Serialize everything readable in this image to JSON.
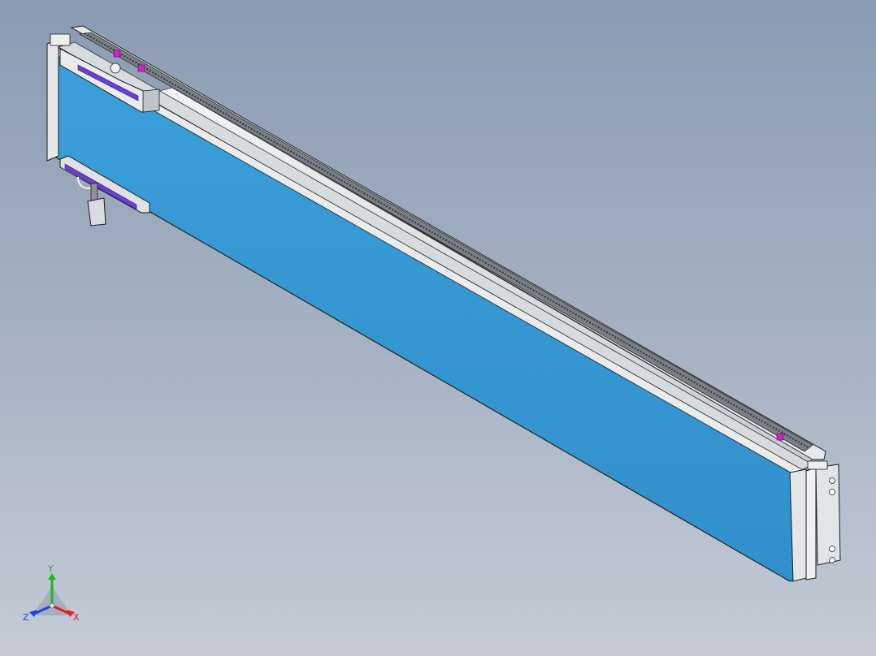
{
  "viewport": {
    "background_top": "#8b9cb2",
    "background_bottom": "#c4cbd6"
  },
  "model": {
    "colors": {
      "body_face": "#3598d3",
      "body_shadow": "#2d85ba",
      "rail_light": "#eceef0",
      "rail_mid": "#c8ccd0",
      "rail_dark": "#8e9398",
      "rack_teeth": "#5c6166",
      "accent_purple": "#6a3fd8",
      "accent_magenta": "#d020c8",
      "outline": "#1c1c1c"
    }
  },
  "triad": {
    "x_label": "X",
    "y_label": "Y",
    "z_label": "Z",
    "x_color": "#e02020",
    "y_color": "#1fb51f",
    "z_color": "#2040e0"
  }
}
